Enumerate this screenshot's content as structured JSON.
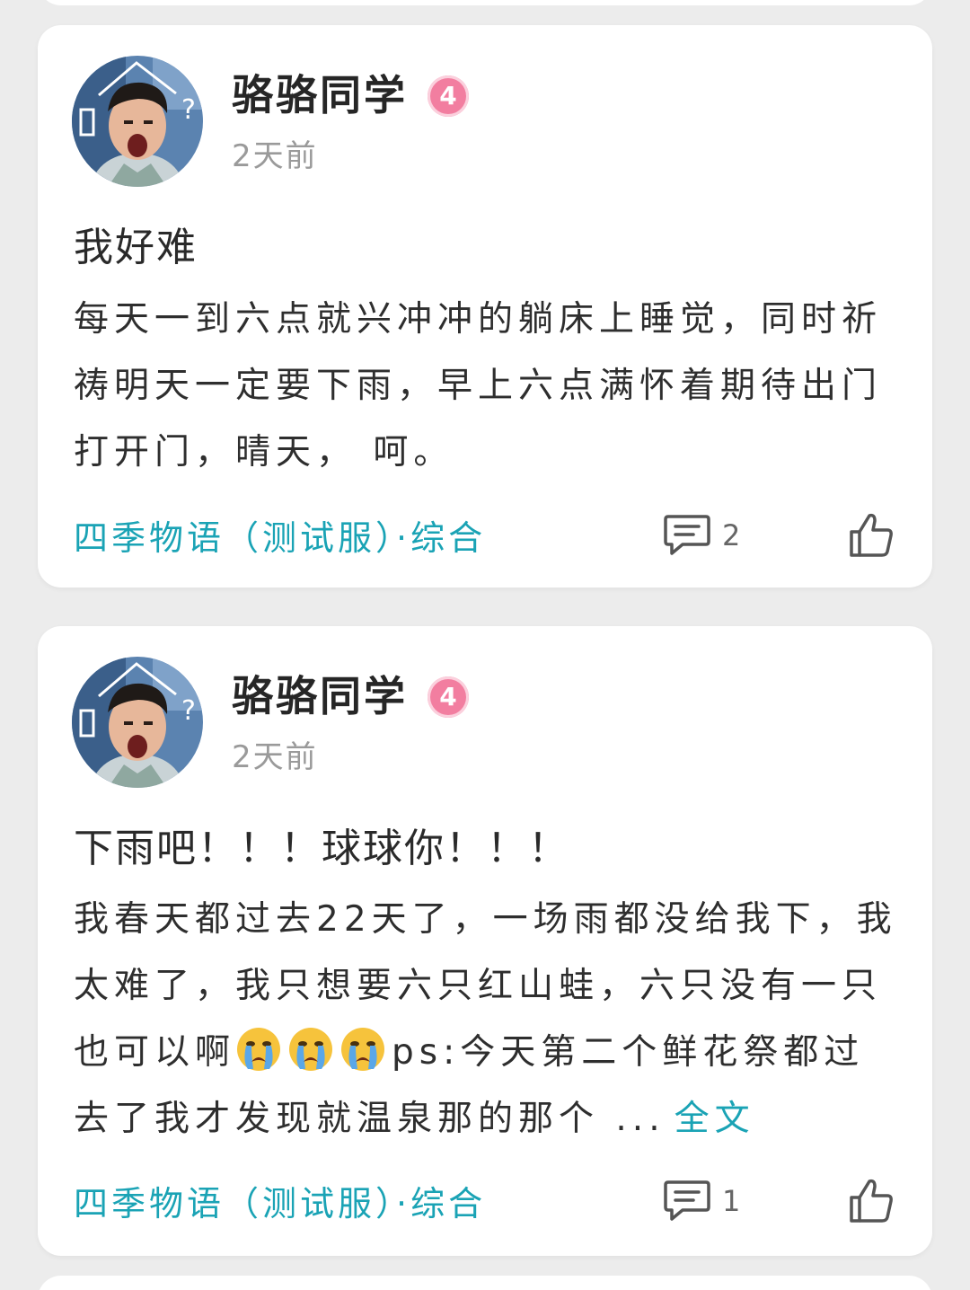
{
  "posts": [
    {
      "username": "骆骆同学",
      "level": "4",
      "time": "2天前",
      "title": "我好难",
      "body": "每天一到六点就兴冲冲的躺床上睡觉，同时祈祷明天一定要下雨，早上六点满怀着期待出门 打开门，晴天， 呵。",
      "topic": "四季物语（测试服）·综合",
      "comment_count": "2"
    },
    {
      "username": "骆骆同学",
      "level": "4",
      "time": "2天前",
      "title": "下雨吧！！！球球你！！！",
      "body_before_emoji": "我春天都过去22天了，一场雨都没给我下，我太难了，我只想要六只红山蛙，六只没有一只也可以啊",
      "emoji_name": "loudly-crying-face-emoji",
      "body_after_emoji": "ps:今天第二个鲜花祭都过去了我才发现就温泉那的那个 ...",
      "more_label": "全文",
      "topic": "四季物语（测试服）·综合",
      "comment_count": "1"
    }
  ],
  "colors": {
    "accent": "#1aa3b5",
    "level_badge": "#f27ea0",
    "time_text": "#9a9a9a",
    "card_bg": "#ffffff",
    "page_bg": "#ececec"
  },
  "icons": {
    "comment": "comment-icon",
    "like": "thumbs-up-icon",
    "avatar": "user-avatar"
  }
}
